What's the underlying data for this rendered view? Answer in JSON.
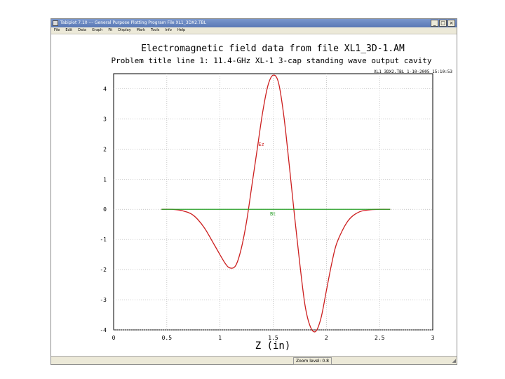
{
  "window": {
    "title": "Tabiplot 7.10 --- General Purpose Plotting Program    File XL1_3DX2.TBL",
    "minimize_glyph": "_",
    "maximize_glyph": "□",
    "close_glyph": "×"
  },
  "menu": {
    "items": [
      "File",
      "Edit",
      "Data",
      "Graph",
      "Fit",
      "Display",
      "Mark",
      "Tools",
      "Info",
      "Help"
    ]
  },
  "status": {
    "text": "Zoom level: 0.8"
  },
  "chart_data": {
    "type": "line",
    "title": "Electromagnetic field data from file XL1_3D-1.AM",
    "subtitle": "Problem title line 1: 11.4-GHz XL-1 3-cap standing wave output cavity",
    "file_stamp": "XL1_3DX2.TBL    1-10-2005  15:10:53",
    "xlabel": "Z (in)",
    "ylabel": "",
    "xlim": [
      0,
      3
    ],
    "ylim": [
      -4,
      4.5
    ],
    "x_tick_labels": [
      "0",
      "0.5",
      "1",
      "1.5",
      "2",
      "2.5",
      "3"
    ],
    "x_tick_values": [
      0,
      0.5,
      1,
      1.5,
      2,
      2.5,
      3
    ],
    "y_tick_labels": [
      "4",
      "3",
      "2",
      "1",
      "0",
      "-1",
      "-2",
      "-3",
      "-4"
    ],
    "y_tick_values": [
      4,
      3,
      2,
      1,
      0,
      -1,
      -2,
      -3,
      -4
    ],
    "grid": true,
    "series": [
      {
        "name": "Ez",
        "color": "#cc1f1f",
        "x": [
          0.45,
          0.55,
          0.65,
          0.75,
          0.85,
          0.95,
          1.05,
          1.1,
          1.15,
          1.2,
          1.25,
          1.3,
          1.35,
          1.4,
          1.45,
          1.5,
          1.55,
          1.6,
          1.65,
          1.7,
          1.75,
          1.8,
          1.85,
          1.9,
          1.95,
          2.0,
          2.05,
          2.1,
          2.2,
          2.3,
          2.4,
          2.5,
          2.6
        ],
        "y": [
          0.0,
          0.0,
          -0.05,
          -0.2,
          -0.6,
          -1.2,
          -1.8,
          -1.95,
          -1.85,
          -1.3,
          -0.4,
          0.8,
          2.0,
          3.2,
          4.1,
          4.45,
          4.2,
          3.1,
          1.5,
          -0.2,
          -1.8,
          -3.2,
          -3.9,
          -4.05,
          -3.6,
          -2.7,
          -1.8,
          -1.1,
          -0.4,
          -0.1,
          -0.02,
          0.0,
          0.0
        ]
      },
      {
        "name": "Bt",
        "color": "#2aa02a",
        "x": [
          0.45,
          2.6
        ],
        "y": [
          0,
          0
        ]
      }
    ],
    "annotations": [
      {
        "text": "Ez",
        "x": 1.36,
        "y": 2.1,
        "color": "#cc1f1f"
      },
      {
        "text": "Bt",
        "x": 1.47,
        "y": -0.2,
        "color": "#2aa02a"
      }
    ]
  }
}
